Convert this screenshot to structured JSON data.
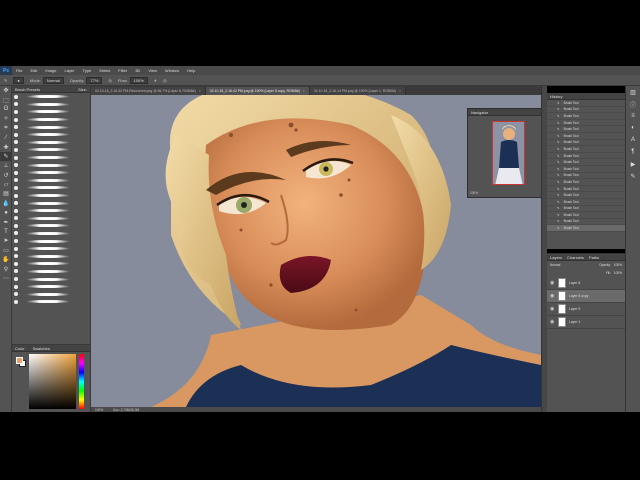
{
  "app": {
    "logo": "Ps",
    "menu": [
      "File",
      "Edit",
      "Image",
      "Layer",
      "Type",
      "Select",
      "Filter",
      "3D",
      "View",
      "Window",
      "Help"
    ]
  },
  "options_bar": {
    "mode_label": "Mode:",
    "mode_value": "Normal",
    "opacity_label": "Opacity:",
    "opacity_value": "77%",
    "flow_label": "Flow:",
    "flow_value": "100%"
  },
  "tabs": [
    {
      "label": "02-10-18_2-16-32 PM-Recovered.png @ 66,7% (Layer 8, RGB/8#)"
    },
    {
      "label": "02-10-18_2-16-42 PM.png @ 100% (Layer 8 copy, RGB/8#)",
      "active": true
    },
    {
      "label": "02-10-18_2-16-14 PM.png @ 100% (Layer 1, RGB/8#)"
    }
  ],
  "panels": {
    "brush_presets_title": "Brush Presets",
    "brush_size_label": "Size:",
    "color_title": "Color",
    "swatches_title": "Swatches",
    "navigator_title": "Navigator",
    "navigator_zoom": "100%",
    "history_title": "History",
    "history_items": [
      "Brush Tool",
      "Brush Tool",
      "Brush Tool",
      "Brush Tool",
      "Brush Tool",
      "Brush Tool",
      "Brush Tool",
      "Brush Tool",
      "Brush Tool",
      "Brush Tool",
      "Brush Tool",
      "Brush Tool",
      "Brush Tool",
      "Brush Tool",
      "Brush Tool",
      "Brush Tool",
      "Brush Tool",
      "Brush Tool",
      "Brush Tool",
      "Brush Tool"
    ],
    "layers_tabs": [
      "Layers",
      "Channels",
      "Paths"
    ],
    "blend_mode": "Normal",
    "opacity_label": "Opacity:",
    "opacity_value": "100%",
    "fill_label": "Fill:",
    "fill_value": "100%",
    "layers": [
      {
        "name": "Layer 8"
      },
      {
        "name": "Layer 8 copy",
        "selected": true
      },
      {
        "name": "Layer 9"
      },
      {
        "name": "Layer 1"
      }
    ]
  },
  "status": {
    "zoom": "100%",
    "doc": "Doc: 2,73M/26,3M"
  },
  "colors": {
    "foreground": "#e8a36c",
    "background": "#ffffff",
    "canvas_bg": "#878c9c"
  }
}
